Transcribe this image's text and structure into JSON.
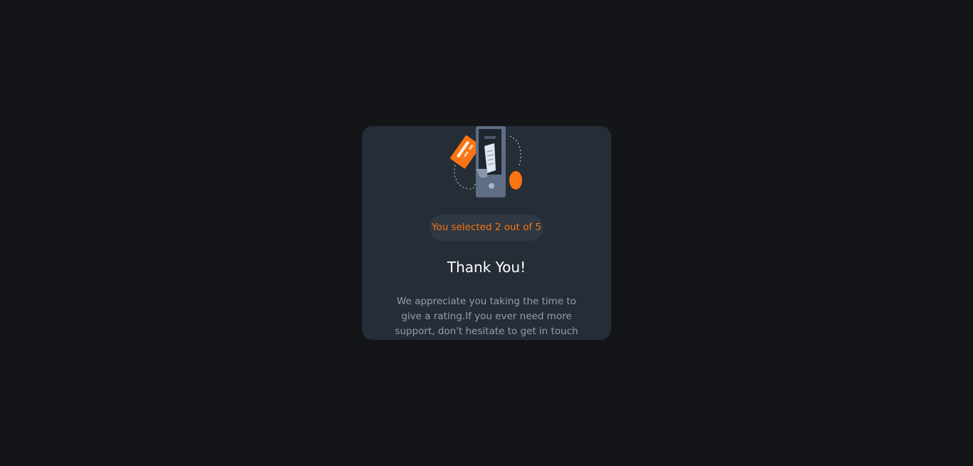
{
  "card": {
    "illustration_icon": "payment-phone-illustration-icon",
    "badge_text": "You selected 2 out of 5",
    "title": "Thank You!",
    "message": "We appreciate you taking the time to give a rating.If you ever need more support, don't hesitate to get in touch"
  },
  "rating": {
    "selected": 2,
    "max": 5
  },
  "colors": {
    "page_background": "#131518",
    "card_background": "#252d37",
    "accent_orange": "#fb7413",
    "badge_background": "#2f3843",
    "title_text": "#ffffff",
    "body_text": "#959eac"
  }
}
